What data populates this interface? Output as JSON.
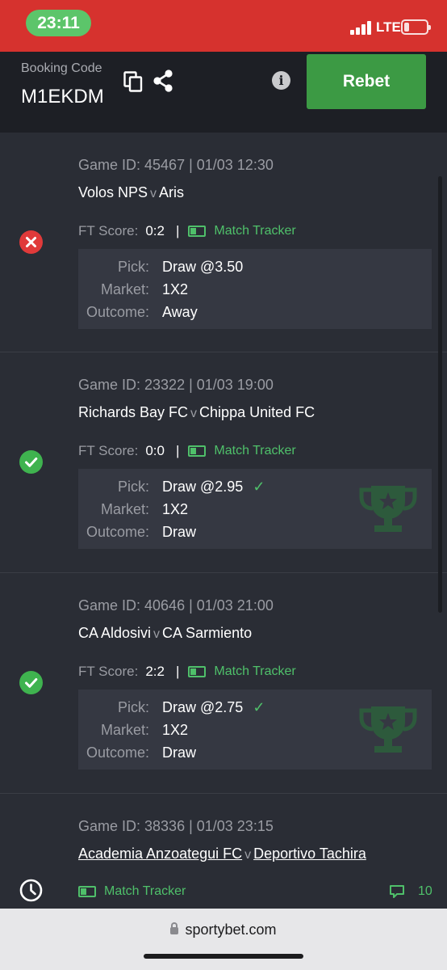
{
  "status_bar": {
    "time": "23:11",
    "network": "LTE"
  },
  "header": {
    "booking_label": "Booking Code",
    "booking_code": "M1EKDM",
    "rebet_label": "Rebet",
    "info_glyph": "i",
    "icons": [
      "copy-icon",
      "share-icon",
      "info-icon"
    ]
  },
  "labels": {
    "ft_score": "FT Score:",
    "match_tracker": "Match Tracker",
    "pick": "Pick:",
    "market": "Market:",
    "outcome": "Outcome:",
    "separator": "|",
    "v": "v",
    "check": "✓"
  },
  "bets": [
    {
      "status": "lost",
      "game": "Game ID: 45467 | 01/03 12:30",
      "home": "Volos NPS",
      "away": "Aris",
      "score": "0:2",
      "pick": "Draw @3.50",
      "market": "1X2",
      "outcome": "Away"
    },
    {
      "status": "won",
      "game": "Game ID: 23322 | 01/03 19:00",
      "home": "Richards Bay FC",
      "away": "Chippa United FC",
      "score": "0:0",
      "pick": "Draw @2.95",
      "market": "1X2",
      "outcome": "Draw"
    },
    {
      "status": "won",
      "game": "Game ID: 40646 | 01/03 21:00",
      "home": "CA Aldosivi",
      "away": "CA Sarmiento",
      "score": "2:2",
      "pick": "Draw @2.75",
      "market": "1X2",
      "outcome": "Draw"
    },
    {
      "status": "pending",
      "game": "Game ID: 38336 | 01/03 23:15",
      "home": "Academia Anzoategui FC",
      "away": "Deportivo Tachira",
      "comments": "10"
    }
  ],
  "colors": {
    "status_bar": "#d6322e",
    "won": "#3fb34f",
    "lost": "#e03a3a",
    "accent": "#4fc06a",
    "rebet": "#3c9a44"
  },
  "browser": {
    "url": "sportybet.com"
  }
}
